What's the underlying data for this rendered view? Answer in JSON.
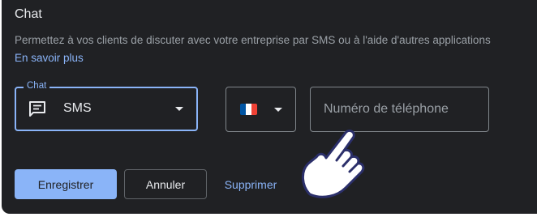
{
  "section": {
    "title": "Chat",
    "description": "Permettez à vos clients de discuter avec votre entreprise par SMS ou à l'aide d'autres applications",
    "learn_more": "En savoir plus"
  },
  "chat_select": {
    "label": "Chat",
    "value": "SMS",
    "icon": "chat-icon"
  },
  "country_select": {
    "flag": "france-flag",
    "flag_colors": [
      "#0055a4",
      "#ffffff",
      "#ef4135"
    ]
  },
  "phone_input": {
    "placeholder": "Numéro de téléphone",
    "value": ""
  },
  "buttons": {
    "save": "Enregistrer",
    "cancel": "Annuler",
    "delete": "Supprimer"
  },
  "colors": {
    "background": "#202124",
    "accent": "#8ab4f8",
    "text": "#e8eaed",
    "muted": "#9aa0a6"
  },
  "pointer": "pointing-hand-cursor"
}
